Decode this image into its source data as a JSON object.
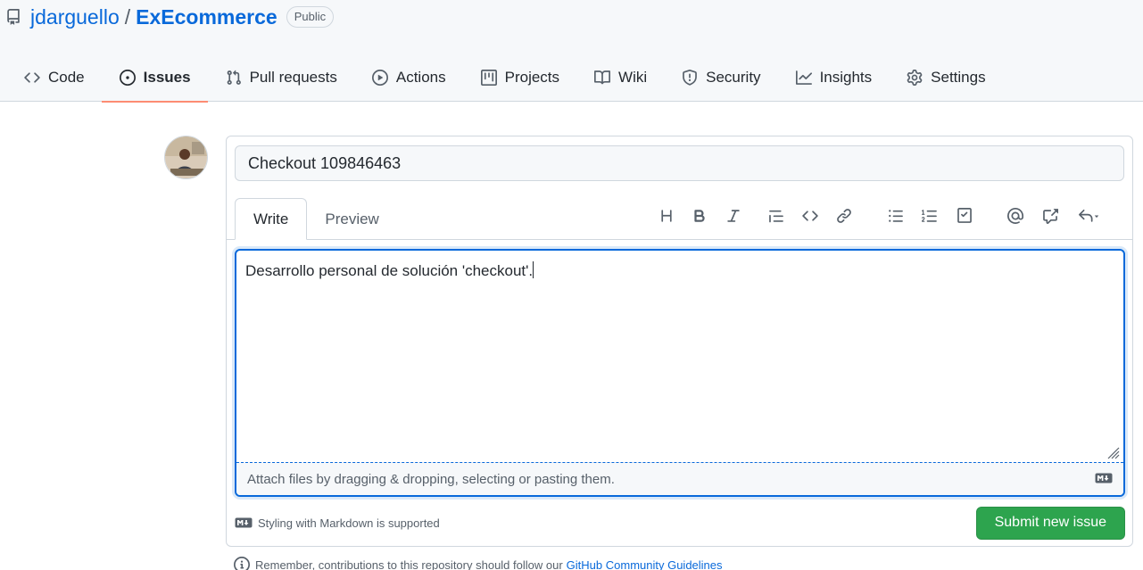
{
  "repo": {
    "owner": "jdarguello",
    "separator": "/",
    "name": "ExEcommerce",
    "visibility": "Public"
  },
  "tabs": [
    {
      "label": "Code",
      "icon": "code-icon"
    },
    {
      "label": "Issues",
      "icon": "issue-opened-icon",
      "selected": true
    },
    {
      "label": "Pull requests",
      "icon": "git-pull-request-icon"
    },
    {
      "label": "Actions",
      "icon": "play-icon"
    },
    {
      "label": "Projects",
      "icon": "table-icon"
    },
    {
      "label": "Wiki",
      "icon": "book-icon"
    },
    {
      "label": "Security",
      "icon": "shield-icon"
    },
    {
      "label": "Insights",
      "icon": "graph-icon"
    },
    {
      "label": "Settings",
      "icon": "gear-icon"
    }
  ],
  "issue": {
    "title_value": "Checkout 109846463",
    "write_tab": "Write",
    "preview_tab": "Preview",
    "body_value": "Desarrollo personal de solución 'checkout'.",
    "attach_text": "Attach files by dragging & dropping, selecting or pasting them.",
    "markdown_note": "Styling with Markdown is supported",
    "submit_label": "Submit new issue"
  },
  "toolbar_icons": [
    "heading-icon",
    "bold-icon",
    "italic-icon",
    "quote-icon",
    "code-icon",
    "link-icon",
    "bulleted-list-icon",
    "numbered-list-icon",
    "task-list-icon",
    "mention-icon",
    "cross-reference-icon",
    "reply-icon"
  ],
  "remember": {
    "text": "Remember, contributions to this repository should follow our",
    "link": "GitHub Community Guidelines"
  },
  "colors": {
    "accent": "#0969da",
    "submit": "#2da44e",
    "selected_tab_underline": "#fd8c73"
  }
}
